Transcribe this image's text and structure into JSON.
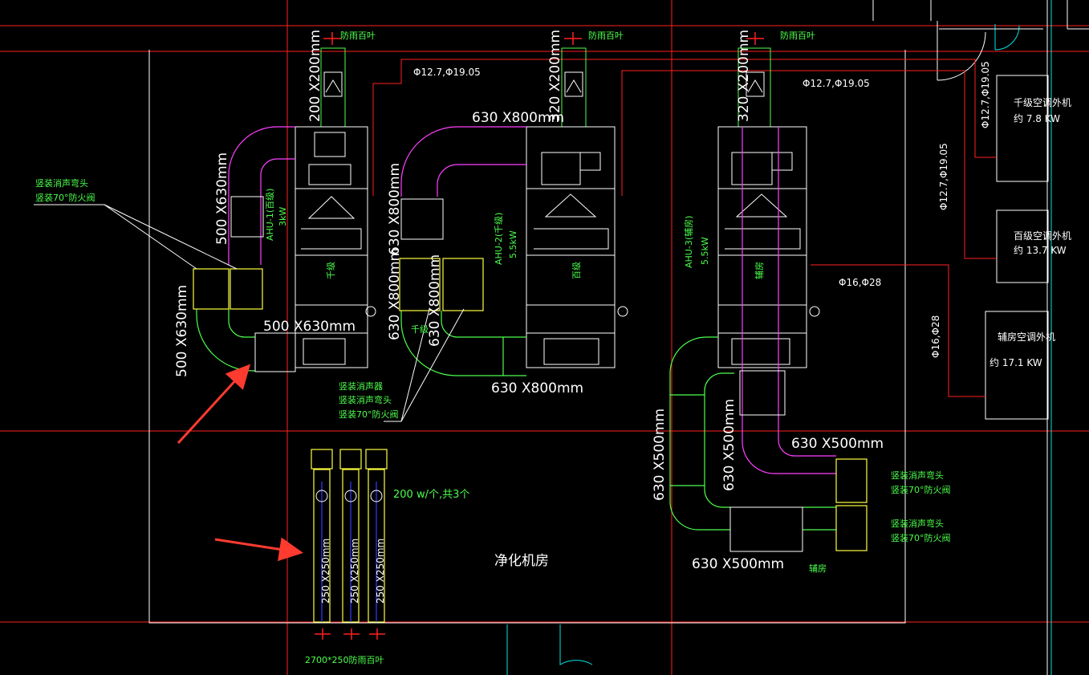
{
  "labels": {
    "louver_top_1": "防雨百叶",
    "louver_top_2": "防雨百叶",
    "louver_top_3": "防雨百叶",
    "pipe_top_1": "Φ12.7,Φ19.05",
    "pipe_top_2": "Φ12.7,Φ19.05",
    "pipe_v1": "Φ12.7,Φ19.05",
    "pipe_v2": "Φ12.7,Φ19.05",
    "pipe_mid": "Φ16,Φ28",
    "pipe_v3": "Φ16,Φ28",
    "duct_200x200_1": "200 X200mm",
    "duct_320x200_2": "320 X200mm",
    "duct_320x200_3": "320 X200mm",
    "duct_630x800_top": "630 X800mm",
    "duct_500x630_a": "500 X630mm",
    "duct_500x630_b": "500 X630mm",
    "duct_500x630_c": "500 X630mm",
    "duct_630x800_v1": "630 X800mm",
    "duct_630x800_v2": "630 X800mm",
    "duct_630x800_v3": "630 X800mm",
    "duct_630x800_bottom": "630 X800mm",
    "duct_630x500_right1": "630 X500mm",
    "duct_630x500_right2": "630 X500mm",
    "duct_630x500_v1": "630 X500mm",
    "duct_630x500_v2": "630 X500mm",
    "duct_250x250_1": "250 X250mm",
    "duct_250x250_2": "250 X250mm",
    "duct_250x250_3": "250 X250mm",
    "ahu1": "AHU-1(百级)",
    "ahu1_kw": "3kW",
    "ahu2": "AHU-2(千级)",
    "ahu2_kw": "5.5kW",
    "ahu3": "AHU-3(辅房)",
    "ahu3_kw": "5.5kW",
    "unit1_tag": "千级",
    "unit2_tag": "百级",
    "unit3_tag": "辅房",
    "note_left_1": "竖装消声弯头",
    "note_left_2": "竖装70°防火阀",
    "note_mid_1": "竖装消声器",
    "note_mid_2": "竖装消声弯头",
    "note_mid_3": "竖装70°防火阀",
    "note_mid_tag": "千级",
    "note_right_a1": "竖装消声弯头",
    "note_right_a2": "竖装70°防火阀",
    "note_right_b1": "竖装消声弯头",
    "note_right_b2": "竖装70°防火阀",
    "fan_note": "200 w/个,共3个",
    "room_name": "净化机房",
    "aux_tag": "辅房",
    "louver_bottom": "2700*250防雨百叶",
    "outdoor1_title": "千级空调外机",
    "outdoor1_kw": "约 7.8 KW",
    "outdoor2_title": "百级空调外机",
    "outdoor2_kw": "约 13.7 KW",
    "outdoor3_title": "辅房空调外机",
    "outdoor3_kw": "约 17.1 KW"
  },
  "colors": {
    "background": "#000000",
    "wall": "#ffffff",
    "grid_red": "#ff2020",
    "pipe_red": "#ff2020",
    "duct_green": "#4cff4c",
    "duct_magenta": "#ff40ff",
    "duct_yellow": "#ffff40",
    "cyan": "#00e5e5",
    "blue": "#3a3aff",
    "arrow": "#ff3b30"
  }
}
